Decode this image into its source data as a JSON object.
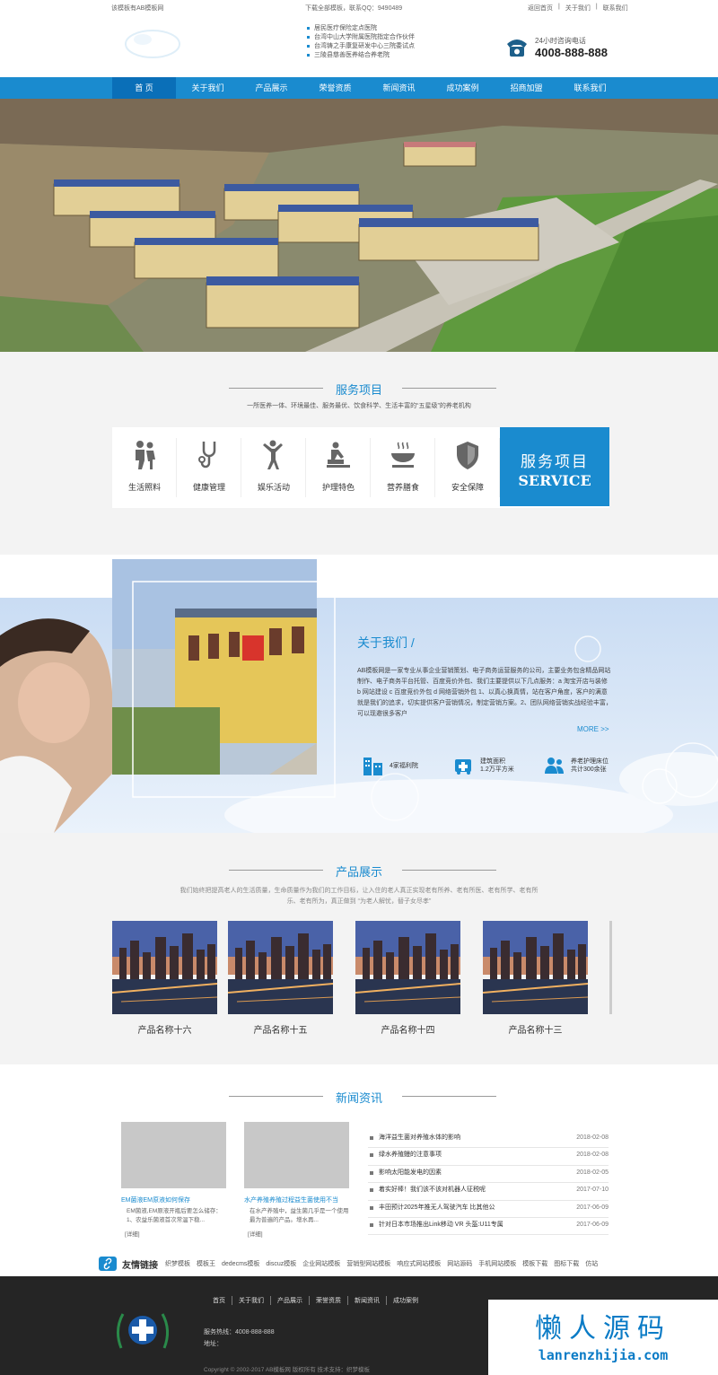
{
  "topbar": {
    "left": "该模板有AB模板网",
    "middle": "下载全部模板，联系QQ：9490489",
    "links": [
      "返回首页",
      "关于我们",
      "联系我们"
    ]
  },
  "header": {
    "mission": [
      "居民医疗保险定点医院",
      "台湾中山大学附属医院指定合作伙伴",
      "台湾铸之手康复研发中心三院委试点",
      "三陵县慈善医养结合养老院"
    ],
    "hotline_label": "24小时咨询电话",
    "hotline": "4008-888-888"
  },
  "nav": [
    "首 页",
    "关于我们",
    "产品展示",
    "荣誉资质",
    "新闻资讯",
    "成功案例",
    "招商加盟",
    "联系我们"
  ],
  "services": {
    "title": "服务项目",
    "subtitle": "一所医养一体、环境最佳、服务最优、饮食科学、生活丰富的“五星级”的养老机构",
    "items": [
      {
        "label": "生活照料",
        "icon": "caregiver-icon"
      },
      {
        "label": "健康管理",
        "icon": "stethoscope-icon"
      },
      {
        "label": "娱乐活动",
        "icon": "exercise-icon"
      },
      {
        "label": "护理特色",
        "icon": "massage-icon"
      },
      {
        "label": "营养膳食",
        "icon": "bowl-icon"
      },
      {
        "label": "安全保障",
        "icon": "shield-icon"
      }
    ],
    "banner_cn": "服务项目",
    "banner_en": "SERVICE"
  },
  "about": {
    "title": "关于我们 /",
    "text": "AB模板网是一家专业从事企业营销策划、电子商务运营服务的公司，主要业务包含精品网站制作、电子商务平台托管、百度竞价外包、我们主要提供以下几点服务：a 淘宝开店与装修 b 网站建设 c 百度竞价外包 d 网络营销外包 1、以真心换真情，站在客户角度，客户的满意就是我们的追求，切实提供客户营销情况，制定营销方案。2、团队网络营销实战经验丰富，可以现邀很多客户",
    "more": "MORE >>",
    "stats": [
      {
        "l1": "4家福利院",
        "l2": "",
        "icon": "building-icon"
      },
      {
        "l1": "建筑面积",
        "l2": "1.2万平方米",
        "icon": "ambulance-icon"
      },
      {
        "l1": "养老护理床位",
        "l2": "共计300余张",
        "icon": "people-icon"
      }
    ]
  },
  "products": {
    "title": "产品展示",
    "subtitle": "我们始终把提高老人的生活质量，生命质量作为我们的工作目标，让入住的老人真正实现老有所养、老有所医、老有所学、老有所乐、老有所为，真正做到 “为老人解忧，替子女尽孝”",
    "items": [
      "产品名称十六",
      "产品名称十五",
      "产品名称十四",
      "产品名称十三"
    ]
  },
  "news": {
    "title": "新闻资讯",
    "cards": [
      {
        "title": "EM菌液EM原液如何保存",
        "desc": "EM菌液,EM原液开瓶后要怎么储存：1、农益乐菌液首次常温下稳...",
        "detail": "[详细]"
      },
      {
        "title": "水产养殖养殖过程益生菌使用不当",
        "desc": "在水产养殖中，益生菌几乎是一个使用最为普遍的产品。增水再...",
        "detail": "[详细]"
      }
    ],
    "list": [
      {
        "t": "海洋益生菌对养殖水体的影响",
        "d": "2018-02-08"
      },
      {
        "t": "绿水养殖鳗的注意事项",
        "d": "2018-02-08"
      },
      {
        "t": "影响太阳能发电的因素",
        "d": "2018-02-05"
      },
      {
        "t": "着实好棒！我们该不该对机器人征税呢",
        "d": "2017-07-10"
      },
      {
        "t": "丰田预计2025年推无人驾驶汽车 比其他公",
        "d": "2017-06-09"
      },
      {
        "t": "针对日本市场推出Link移动 VR 头盔:U11专属",
        "d": "2017-06-09"
      }
    ]
  },
  "links": {
    "title": "友情链接",
    "items": [
      "织梦模板",
      "模板王",
      "dedecms模板",
      "discuz模板",
      "企业网站模板",
      "营销型网站模板",
      "响应式网站模板",
      "网站源码",
      "手机网站模板",
      "模板下载",
      "图标下载",
      "仿站"
    ]
  },
  "footer": {
    "nav": [
      "首页",
      "关于我们",
      "产品展示",
      "荣誉资质",
      "新闻资讯",
      "成功案例"
    ],
    "hotline": "服务热线：4008-888-888",
    "address": "地址：",
    "copy": "Copyright © 2002-2017 AB模板网 版权所有  技术支持：织梦模板"
  },
  "watermark": {
    "cn": "懒人源码",
    "url": "lanrenzhijia.com"
  },
  "colors": {
    "primary": "#1a8bcf",
    "footer": "#252525"
  }
}
